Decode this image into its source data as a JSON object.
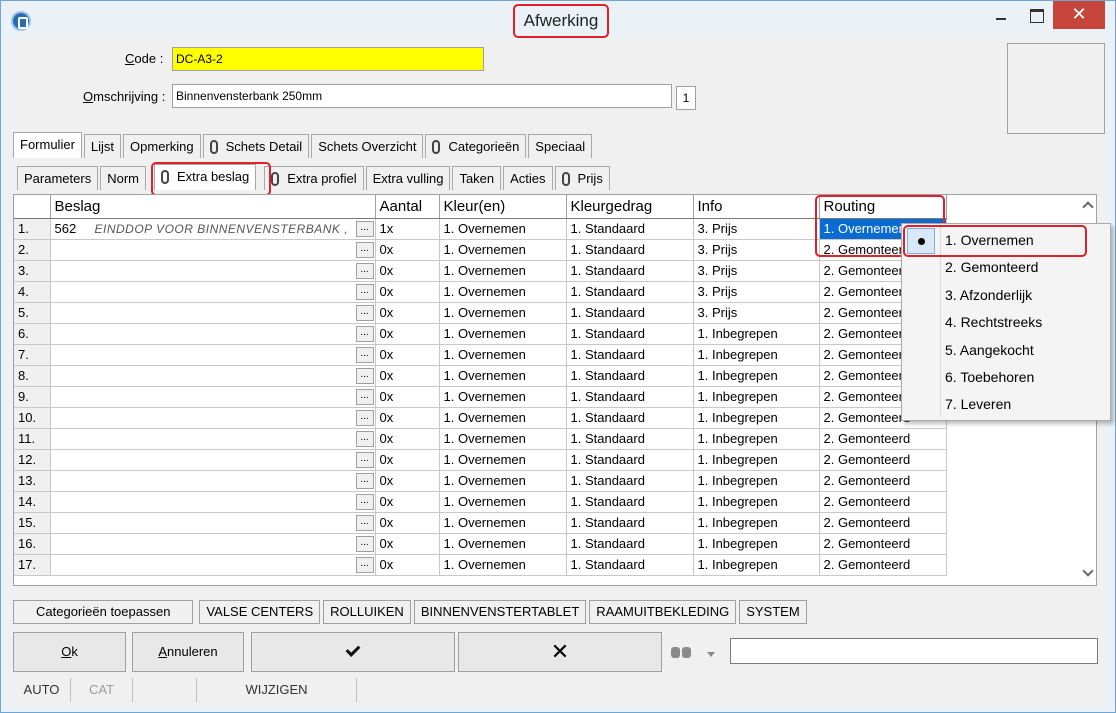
{
  "window": {
    "title": "Afwerking",
    "close_glyph": "✕"
  },
  "form": {
    "code_label_key": "C",
    "code_label_rest": "ode :",
    "code_value": "DC-A3-2",
    "desc_label_key": "O",
    "desc_label_rest": "mschrijving :",
    "desc_value": "Binnenvensterbank 250mm",
    "desc_counter": "1"
  },
  "main_tabs": [
    "Formulier",
    "Lijst",
    "Opmerking",
    "Schets Detail",
    "Schets Overzicht",
    "Categorieën",
    "Speciaal"
  ],
  "sub_tabs": [
    "Parameters",
    "Norm",
    "Extra beslag",
    "Extra profiel",
    "Extra vulling",
    "Taken",
    "Acties",
    "Prijs"
  ],
  "grid": {
    "columns": [
      "Beslag",
      "Aantal",
      "Kleur(en)",
      "Kleurgedrag",
      "Info",
      "Routing"
    ],
    "ellipsis": "...",
    "rows": [
      {
        "n": "1.",
        "code": "562",
        "desc": "EINDDOP VOOR BINNENVENSTERBANK ,",
        "aantal": "1x",
        "kleur": "1. Overnemen",
        "gedrag": "1. Standaard",
        "info": "3. Prijs",
        "routing": "1. Overnemen"
      },
      {
        "n": "2.",
        "code": "",
        "desc": "",
        "aantal": "0x",
        "kleur": "1. Overnemen",
        "gedrag": "1. Standaard",
        "info": "3. Prijs",
        "routing": "2. Gemonteerd"
      },
      {
        "n": "3.",
        "code": "",
        "desc": "",
        "aantal": "0x",
        "kleur": "1. Overnemen",
        "gedrag": "1. Standaard",
        "info": "3. Prijs",
        "routing": "2. Gemonteerd"
      },
      {
        "n": "4.",
        "code": "",
        "desc": "",
        "aantal": "0x",
        "kleur": "1. Overnemen",
        "gedrag": "1. Standaard",
        "info": "3. Prijs",
        "routing": "2. Gemonteerd"
      },
      {
        "n": "5.",
        "code": "",
        "desc": "",
        "aantal": "0x",
        "kleur": "1. Overnemen",
        "gedrag": "1. Standaard",
        "info": "3. Prijs",
        "routing": "2. Gemonteerd"
      },
      {
        "n": "6.",
        "code": "",
        "desc": "",
        "aantal": "0x",
        "kleur": "1. Overnemen",
        "gedrag": "1. Standaard",
        "info": "1. Inbegrepen",
        "routing": "2. Gemonteerd"
      },
      {
        "n": "7.",
        "code": "",
        "desc": "",
        "aantal": "0x",
        "kleur": "1. Overnemen",
        "gedrag": "1. Standaard",
        "info": "1. Inbegrepen",
        "routing": "2. Gemonteerd"
      },
      {
        "n": "8.",
        "code": "",
        "desc": "",
        "aantal": "0x",
        "kleur": "1. Overnemen",
        "gedrag": "1. Standaard",
        "info": "1. Inbegrepen",
        "routing": "2. Gemonteerd"
      },
      {
        "n": "9.",
        "code": "",
        "desc": "",
        "aantal": "0x",
        "kleur": "1. Overnemen",
        "gedrag": "1. Standaard",
        "info": "1. Inbegrepen",
        "routing": "2. Gemonteerd"
      },
      {
        "n": "10.",
        "code": "",
        "desc": "",
        "aantal": "0x",
        "kleur": "1. Overnemen",
        "gedrag": "1. Standaard",
        "info": "1. Inbegrepen",
        "routing": "2. Gemonteerd"
      },
      {
        "n": "11.",
        "code": "",
        "desc": "",
        "aantal": "0x",
        "kleur": "1. Overnemen",
        "gedrag": "1. Standaard",
        "info": "1. Inbegrepen",
        "routing": "2. Gemonteerd"
      },
      {
        "n": "12.",
        "code": "",
        "desc": "",
        "aantal": "0x",
        "kleur": "1. Overnemen",
        "gedrag": "1. Standaard",
        "info": "1. Inbegrepen",
        "routing": "2. Gemonteerd"
      },
      {
        "n": "13.",
        "code": "",
        "desc": "",
        "aantal": "0x",
        "kleur": "1. Overnemen",
        "gedrag": "1. Standaard",
        "info": "1. Inbegrepen",
        "routing": "2. Gemonteerd"
      },
      {
        "n": "14.",
        "code": "",
        "desc": "",
        "aantal": "0x",
        "kleur": "1. Overnemen",
        "gedrag": "1. Standaard",
        "info": "1. Inbegrepen",
        "routing": "2. Gemonteerd"
      },
      {
        "n": "15.",
        "code": "",
        "desc": "",
        "aantal": "0x",
        "kleur": "1. Overnemen",
        "gedrag": "1. Standaard",
        "info": "1. Inbegrepen",
        "routing": "2. Gemonteerd"
      },
      {
        "n": "16.",
        "code": "",
        "desc": "",
        "aantal": "0x",
        "kleur": "1. Overnemen",
        "gedrag": "1. Standaard",
        "info": "1. Inbegrepen",
        "routing": "2. Gemonteerd"
      },
      {
        "n": "17.",
        "code": "",
        "desc": "",
        "aantal": "0x",
        "kleur": "1. Overnemen",
        "gedrag": "1. Standaard",
        "info": "1. Inbegrepen",
        "routing": "2. Gemonteerd"
      }
    ]
  },
  "routing_dropdown": {
    "options": [
      "1. Overnemen",
      "2. Gemonteerd",
      "3. Afzonderlijk",
      "4. Rechtstreeks",
      "5. Aangekocht",
      "6. Toebehoren",
      "7. Leveren"
    ],
    "selected_index": 0
  },
  "category_buttons": [
    "Categorieën toepassen",
    "VALSE CENTERS",
    "ROLLUIKEN",
    "BINNENVENSTERTABLET",
    "RAAMUITBEKLEDING",
    "SYSTEM"
  ],
  "actions": {
    "ok_key": "O",
    "ok_rest": "k",
    "cancel_key": "A",
    "cancel_rest": "nnuleren",
    "search_value": ""
  },
  "status": [
    "AUTO",
    "CAT",
    "",
    "WIJZIGEN"
  ],
  "colors": {
    "highlight": "#e0202a",
    "selection": "#0a6bd1",
    "code_bg": "#ffff00"
  }
}
